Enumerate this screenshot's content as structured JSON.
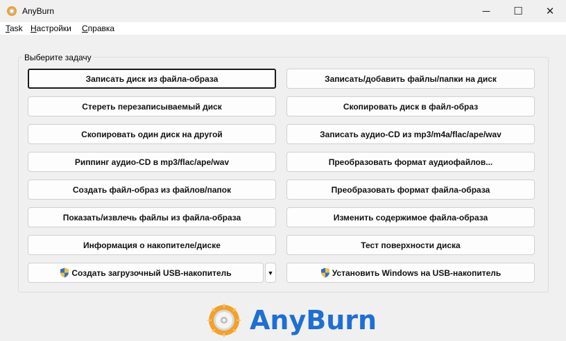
{
  "window": {
    "title": "AnyBurn",
    "minimize_glyph": "─",
    "maximize_glyph": "☐",
    "close_glyph": "✕"
  },
  "menu": {
    "task_u": "T",
    "task_rest": "ask",
    "settings_u": "Н",
    "settings_rest": "астройки",
    "help_u": "С",
    "help_rest": "правка"
  },
  "group": {
    "label": "Выберите задачу"
  },
  "buttons": {
    "burn_image": "Записать диск из файла-образа",
    "burn_files": "Записать/добавить файлы/папки на диск",
    "erase_disc": "Стереть перезаписываемый диск",
    "copy_to_image": "Скопировать диск в файл-образ",
    "copy_disc": "Скопировать один диск на другой",
    "burn_audio": "Записать аудио-CD из mp3/m4a/flac/ape/wav",
    "rip_audio": "Риппинг аудио-CD в mp3/flac/ape/wav",
    "convert_audio": "Преобразовать формат аудиофайлов...",
    "create_image": "Создать файл-образ из файлов/папок",
    "convert_image": "Преобразовать формат файла-образа",
    "extract_image": "Показать/извлечь файлы из файла-образа",
    "edit_image": "Изменить содержимое файла-образа",
    "drive_info": "Информация о накопителе/диске",
    "surface_test": "Тест поверхности диска",
    "bootable_usb": "Создать загрузочный USB-накопитель",
    "bootable_usb_arrow": "▼",
    "install_windows": "Установить Windows на USB-накопитель"
  },
  "logo": {
    "text": "AnyBurn"
  },
  "colors": {
    "brand_blue": "#1e6fd3",
    "brand_orange": "#f2a12a",
    "background": "#f0f0f0"
  },
  "icons": {
    "app": "anyburn-disc-icon",
    "uac_shield": "uac-shield-icon"
  }
}
